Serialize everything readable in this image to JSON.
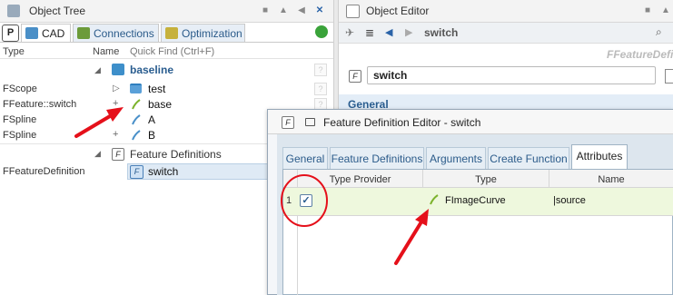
{
  "left_panel": {
    "title": "Object Tree",
    "tabs": [
      {
        "label": "P"
      },
      {
        "label": "CAD"
      },
      {
        "label": "Connections"
      },
      {
        "label": "Optimization"
      }
    ],
    "columns": {
      "type": "Type",
      "name": "Name",
      "quick_find_placeholder": "Quick Find (Ctrl+F)"
    },
    "root": {
      "label": "baseline"
    },
    "rows": [
      {
        "type": "FScope",
        "expander": "▷",
        "name": "test"
      },
      {
        "type": "FFeature::switch",
        "expander": "+",
        "name": "base"
      },
      {
        "type": "FSpline",
        "expander": "",
        "name": "A"
      },
      {
        "type": "FSpline",
        "expander": "+",
        "name": "B"
      }
    ],
    "feature_defs": {
      "label": "Feature Definitions"
    },
    "feature_def_row": {
      "type": "FFeatureDefinition",
      "name": "switch"
    }
  },
  "right_panel": {
    "title": "Object Editor",
    "breadcrumb": "switch",
    "name_value": "switch",
    "class_text": "FFeatureDefi",
    "section_label": "General"
  },
  "dialog": {
    "title": "Feature Definition Editor - switch",
    "tabs": [
      "General",
      "Feature Definitions",
      "Arguments",
      "Create Function",
      "Attributes"
    ],
    "active_tab": "Attributes",
    "columns": [
      "Type Provider",
      "Type",
      "Name"
    ],
    "rows": [
      {
        "index": "1",
        "checked": true,
        "type": "FImageCurve",
        "name": "|source"
      }
    ]
  },
  "colors": {
    "arrow": "#e5101a",
    "circle": "#e5101a",
    "row_highlight": "#eef8dd",
    "tab_text": "#2b5b8a"
  }
}
